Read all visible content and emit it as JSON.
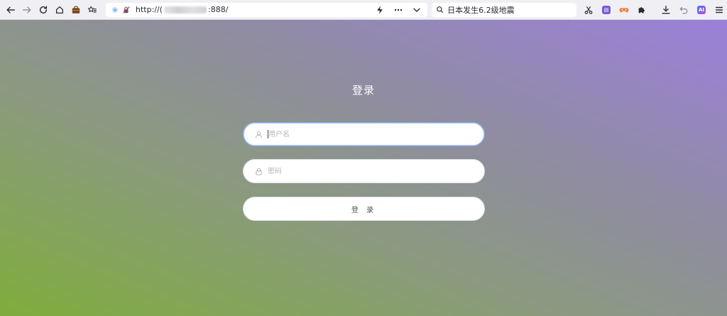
{
  "browser": {
    "url_prefix": "http://",
    "url_partial_start": "(",
    "url_suffix": ":888/",
    "search_text": "日本发生6.2级地震",
    "ext_ai_label": "AI"
  },
  "login": {
    "title": "登录",
    "username_placeholder": "用户名",
    "password_placeholder": "密码",
    "submit_label": "登 录"
  },
  "colors": {
    "gradient_bottom_left": "#7fad3c",
    "gradient_top_right": "#9b80da",
    "focus_border": "#7fa8e6"
  }
}
